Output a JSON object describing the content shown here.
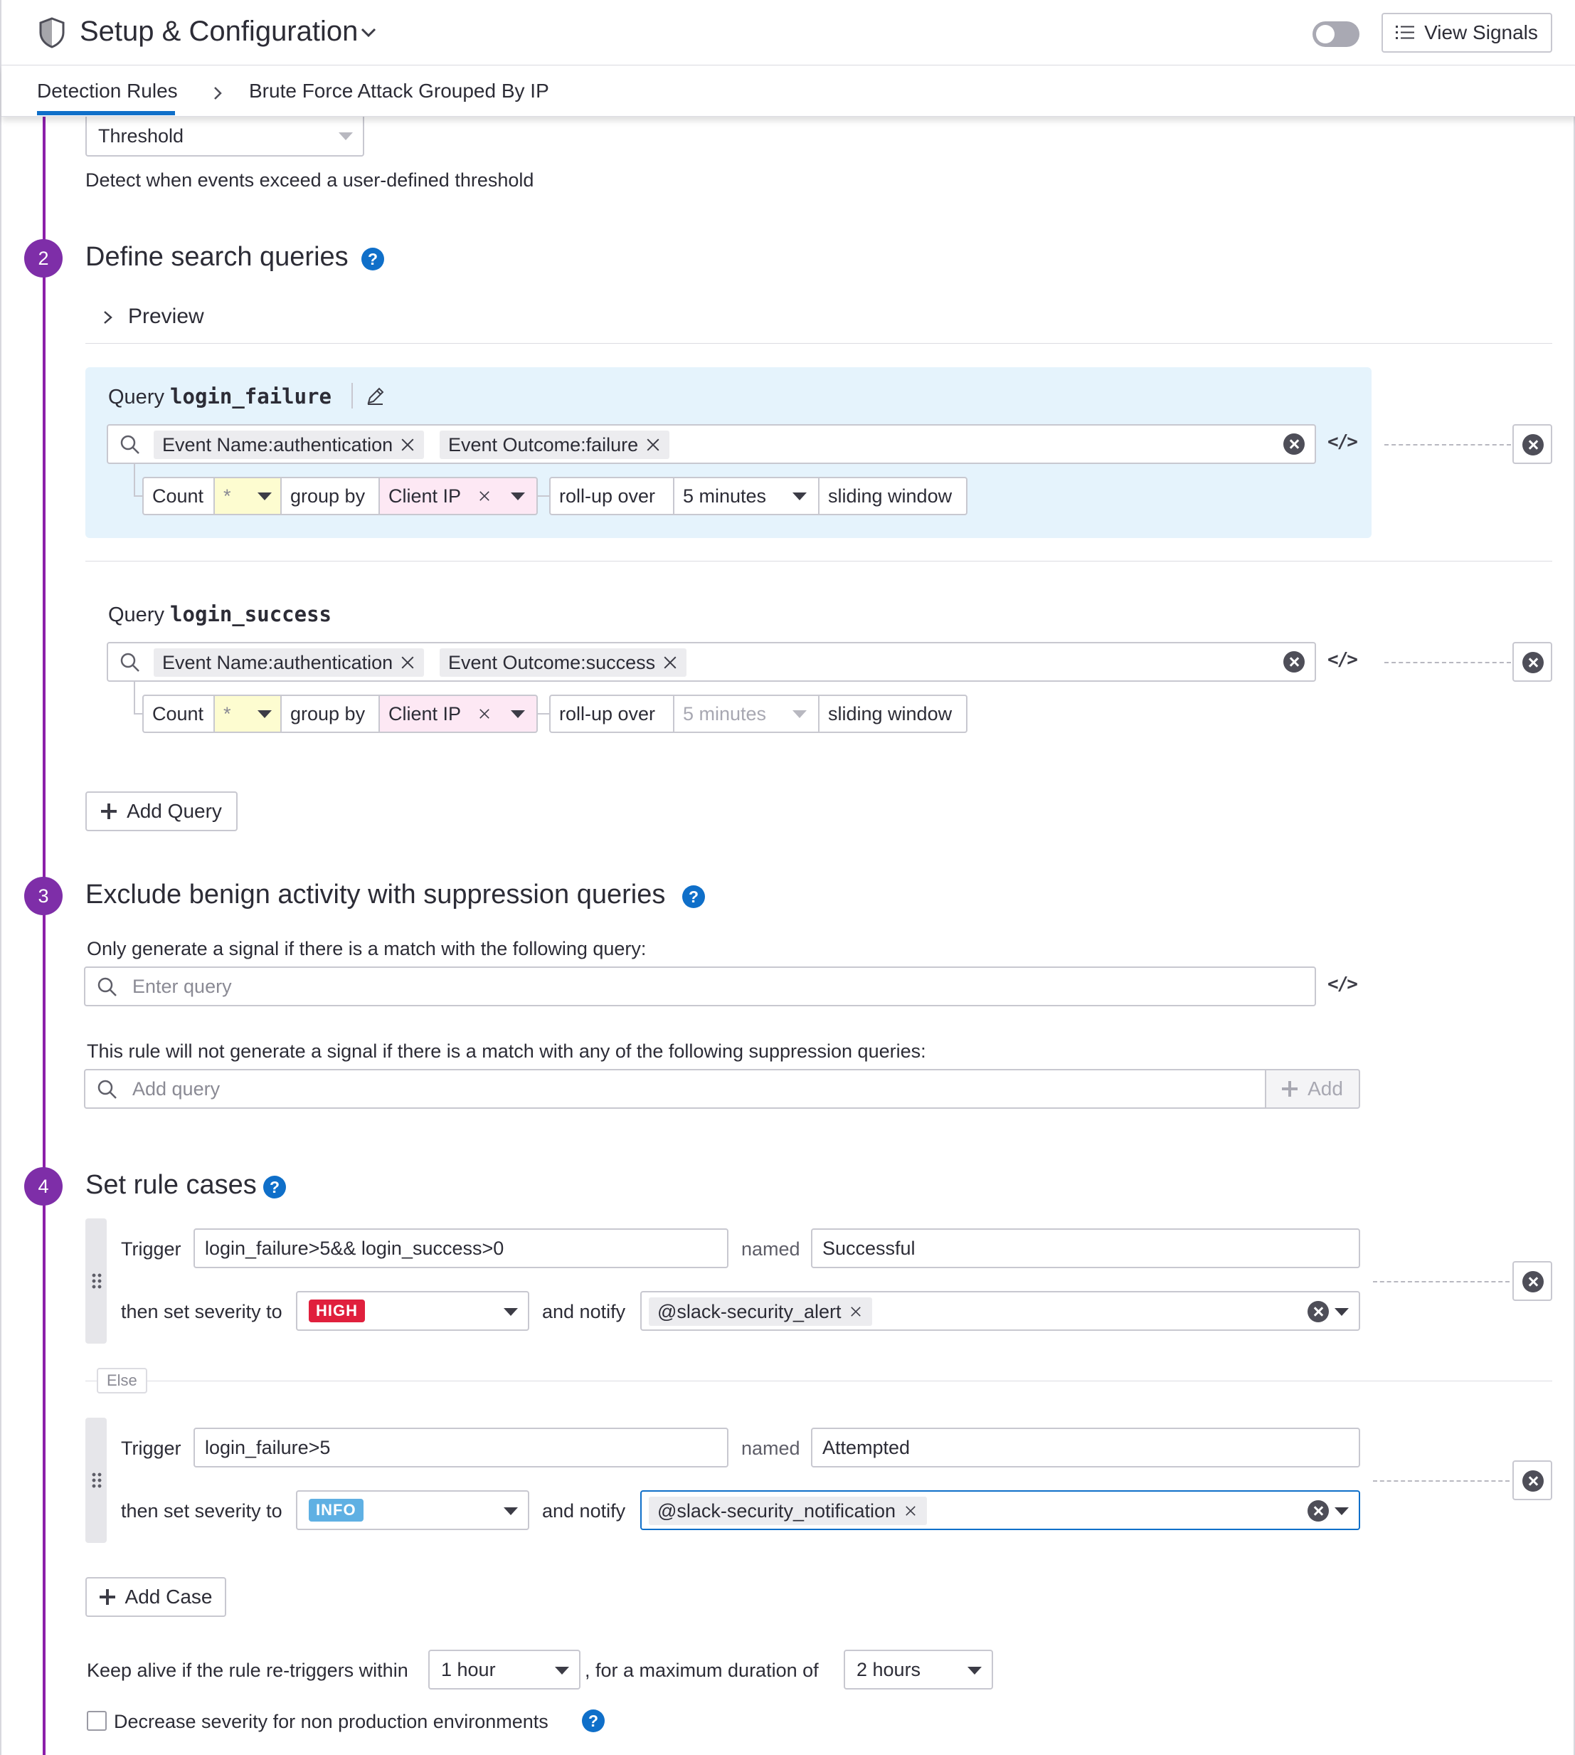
{
  "header": {
    "title": "Setup & Configuration",
    "view_signals_label": "View Signals"
  },
  "subnav": {
    "tab_label": "Detection Rules",
    "breadcrumb_current": "Brute Force Attack Grouped By IP"
  },
  "step1": {
    "method_value": "Threshold",
    "method_description": "Detect when events exceed a user-defined threshold"
  },
  "step2": {
    "number": "2",
    "title": "Define search queries",
    "preview_label": "Preview",
    "queries": [
      {
        "label_prefix": "Query",
        "name": "login_failure",
        "tags": [
          "Event Name:authentication",
          "Event Outcome:failure"
        ],
        "aggregation": "Count",
        "measure": "*",
        "group_by_label": "group by",
        "group_by_value": "Client IP",
        "rollup_label": "roll-up over",
        "rollup_value": "5 minutes",
        "window_label": "sliding window"
      },
      {
        "label_prefix": "Query",
        "name": "login_success",
        "tags": [
          "Event Name:authentication",
          "Event Outcome:success"
        ],
        "aggregation": "Count",
        "measure": "*",
        "group_by_label": "group by",
        "group_by_value": "Client IP",
        "rollup_label": "roll-up over",
        "rollup_value": "5 minutes",
        "window_label": "sliding window"
      }
    ],
    "add_query_label": "Add Query"
  },
  "step3": {
    "number": "3",
    "title": "Exclude benign activity with suppression queries",
    "match_label": "Only generate a signal if there is a match with the following query:",
    "match_placeholder": "Enter query",
    "suppression_label": "This rule will not generate a signal if there is a match with any of the following suppression queries:",
    "suppression_placeholder": "Add query",
    "add_label": "Add"
  },
  "step4": {
    "number": "4",
    "title": "Set rule cases",
    "cases": [
      {
        "trigger_label": "Trigger",
        "trigger_value": "login_failure>5&& login_success>0",
        "named_label": "named",
        "name_value": "Successful",
        "severity_label": "then set severity to",
        "severity": "HIGH",
        "notify_label": "and notify",
        "notify_value": "@slack-security_alert"
      },
      {
        "trigger_label": "Trigger",
        "trigger_value": "login_failure>5",
        "named_label": "named",
        "name_value": "Attempted",
        "severity_label": "then set severity to",
        "severity": "INFO",
        "notify_label": "and notify",
        "notify_value": "@slack-security_notification"
      }
    ],
    "else_label": "Else",
    "add_case_label": "Add Case",
    "keep_alive_label": "Keep alive if the rule re-triggers within",
    "keep_alive_value": "1 hour",
    "max_duration_label": ", for a maximum duration of",
    "max_duration_value": "2 hours",
    "decrease_severity_label": "Decrease severity for non production environments"
  },
  "colors": {
    "accent": "#0f6fc9",
    "timeline": "#8b1fa9",
    "step_circle": "#7e2ea8",
    "query_bg": "#e5f3fc",
    "measure_bg": "#fdfcd0",
    "group_bg": "#fde8f4",
    "severity_high": "#e0203d",
    "severity_info": "#5fb0e3"
  },
  "icons": [
    "shield-icon",
    "chevron-down-icon",
    "list-icon",
    "chevron-right-icon",
    "help-icon",
    "search-icon",
    "close-icon",
    "code-icon",
    "clear-icon",
    "pencil-icon",
    "plus-icon",
    "drag-handle-icon"
  ]
}
